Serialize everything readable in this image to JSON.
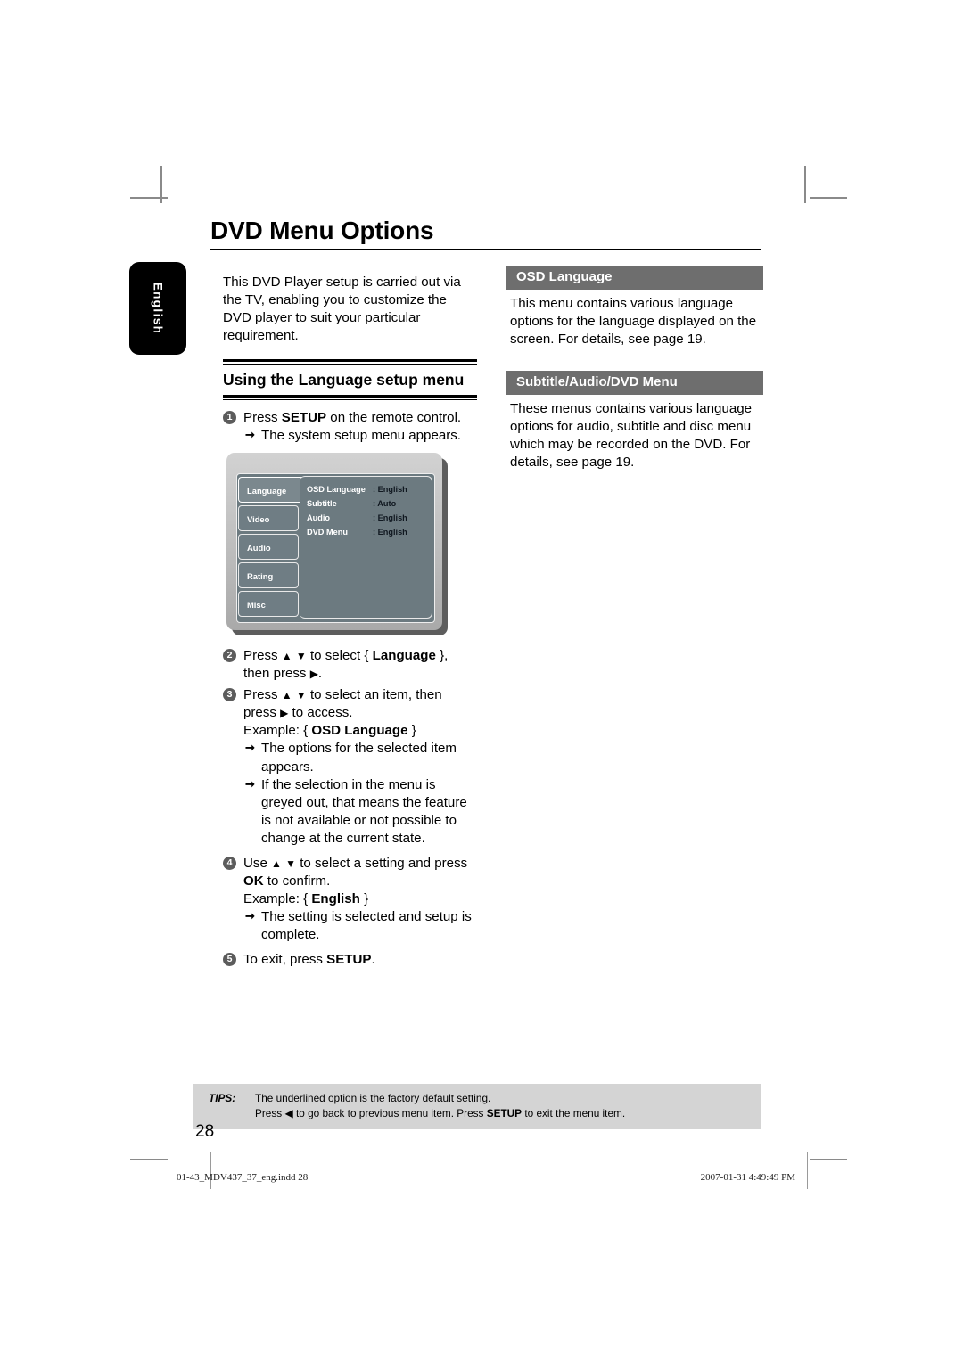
{
  "document": {
    "title": "DVD Menu Options",
    "side_tab": "English",
    "page_number": "28"
  },
  "left_column": {
    "intro": "This DVD Player setup is carried out via the TV, enabling you to customize the DVD player to suit your particular requirement.",
    "section_heading": "Using the Language setup menu",
    "steps": [
      {
        "num": "1",
        "text_parts": [
          "Press ",
          "SETUP",
          " on the remote control."
        ],
        "text_plain": "Press SETUP on the remote control.",
        "arrows": [
          "The system setup menu appears."
        ]
      },
      {
        "num": "2",
        "text_plain": "Press ▲ ▼ to select { Language }, then press ▶.",
        "arrows": []
      },
      {
        "num": "3",
        "text_plain": "Press ▲ ▼ to select an item, then press ▶ to access.",
        "example": "Example: { OSD Language }",
        "example_label": "Example: {",
        "example_value": "OSD Language",
        "example_close": "}",
        "arrows": [
          "The options for the selected item appears.",
          "If the selection in the menu is greyed out, that means the feature is not available or not possible to change at the current state."
        ]
      },
      {
        "num": "4",
        "text_plain": "Use ▲ ▼ to select a setting and press OK to confirm.",
        "example_label": "Example: {",
        "example_value": "English",
        "example_close": "}",
        "arrows": [
          "The setting is selected and setup is complete."
        ]
      },
      {
        "num": "5",
        "text_plain": "To exit, press SETUP.",
        "arrows": []
      }
    ]
  },
  "right_column": {
    "sections": [
      {
        "header": "OSD Language",
        "body": "This menu contains various language options for the language displayed on the screen. For details, see page 19."
      },
      {
        "header": "Subtitle/Audio/DVD Menu",
        "body": "These menus contains various language options for audio, subtitle and disc menu which may be recorded on the DVD. For details, see page 19."
      }
    ]
  },
  "osd_menu": {
    "sidebar_items": [
      "Language",
      "Video",
      "Audio",
      "Rating",
      "Misc"
    ],
    "active_item": "Language",
    "rows": [
      {
        "label": "OSD Language",
        "value": ": English"
      },
      {
        "label": "Subtitle",
        "value": ": Auto"
      },
      {
        "label": "Audio",
        "value": ": English"
      },
      {
        "label": "DVD Menu",
        "value": ": English"
      }
    ],
    "colors": {
      "panel_bg": "#6c7a80",
      "frame_bg": "#c4c4c4",
      "tab_bg": "#6f7d84",
      "active_tab_bg": "#7b888e"
    }
  },
  "tips": {
    "label": "TIPS:",
    "line1_pre": "The ",
    "line1_underlined": "underlined option",
    "line1_post": " is the factory default setting.",
    "line2_plain": "Press ◀ to go back to previous menu item. Press SETUP to exit the menu item.",
    "line2_a": "Press ",
    "line2_tri": "◀",
    "line2_b": " to go back to previous menu item. Press ",
    "line2_bold": "SETUP",
    "line2_c": " to exit the menu item."
  },
  "footer": {
    "file_name": "01-43_MDV437_37_eng.indd   28",
    "timestamp": "2007-01-31   4:49:49 PM"
  },
  "colors": {
    "grey_header": "#6e6e6e",
    "tips_bg": "#d4d4d4",
    "tab_black": "#000000"
  }
}
